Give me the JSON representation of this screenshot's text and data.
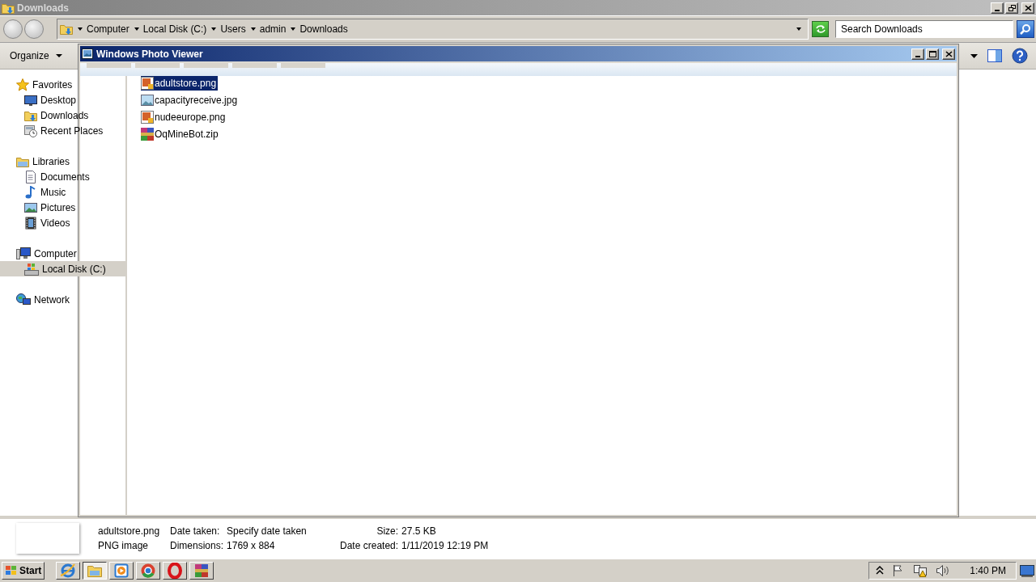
{
  "window": {
    "title": "Downloads"
  },
  "address_bar": {
    "breadcrumbs": [
      "Computer",
      "Local Disk (C:)",
      "Users",
      "admin",
      "Downloads"
    ]
  },
  "search": {
    "placeholder": "Search Downloads"
  },
  "toolbar": {
    "organize": "Organize"
  },
  "sidebar": {
    "groups": [
      {
        "label": "Favorites",
        "kind": "star",
        "selected": false,
        "children": [
          {
            "label": "Desktop",
            "kind": "desktop",
            "selected": false
          },
          {
            "label": "Downloads",
            "kind": "downloads",
            "selected": false
          },
          {
            "label": "Recent Places",
            "kind": "recent",
            "selected": false
          }
        ]
      },
      {
        "label": "Libraries",
        "kind": "library",
        "selected": false,
        "children": [
          {
            "label": "Documents",
            "kind": "documents",
            "selected": false
          },
          {
            "label": "Music",
            "kind": "music",
            "selected": false
          },
          {
            "label": "Pictures",
            "kind": "pictures",
            "selected": false
          },
          {
            "label": "Videos",
            "kind": "videos",
            "selected": false
          }
        ]
      },
      {
        "label": "Computer",
        "kind": "computer",
        "selected": false,
        "children": [
          {
            "label": "Local Disk (C:)",
            "kind": "disk",
            "selected": true
          }
        ]
      },
      {
        "label": "Network",
        "kind": "network",
        "selected": false
      }
    ]
  },
  "files": [
    {
      "name": "adultstore.png",
      "kind": "png",
      "selected": true
    },
    {
      "name": "capacityreceive.jpg",
      "kind": "jpg",
      "selected": false
    },
    {
      "name": "nudeeurope.png",
      "kind": "png",
      "selected": false
    },
    {
      "name": "OqMineBot.zip",
      "kind": "zip",
      "selected": false
    }
  ],
  "photo_viewer": {
    "title": "Windows Photo Viewer"
  },
  "details": {
    "name": "adultstore.png",
    "type": "PNG image",
    "fields": [
      {
        "label": "Date taken:",
        "value": "Specify date taken"
      },
      {
        "label": "Size:",
        "value": "27.5 KB"
      },
      {
        "label": "Dimensions:",
        "value": "1769 x 884"
      },
      {
        "label": "Date created:",
        "value": "1/11/2019 12:19 PM"
      }
    ]
  },
  "taskbar": {
    "start": "Start",
    "apps": [
      {
        "kind": "ie",
        "selected": false
      },
      {
        "kind": "explorer",
        "selected": true
      },
      {
        "kind": "media",
        "selected": false
      },
      {
        "kind": "chrome",
        "selected": false
      },
      {
        "kind": "opera",
        "selected": false
      },
      {
        "kind": "winrar",
        "selected": false
      }
    ],
    "tray": [
      {
        "kind": "chevron"
      },
      {
        "kind": "flag"
      },
      {
        "kind": "network"
      },
      {
        "kind": "volume"
      }
    ],
    "clock": "1:40 PM"
  }
}
